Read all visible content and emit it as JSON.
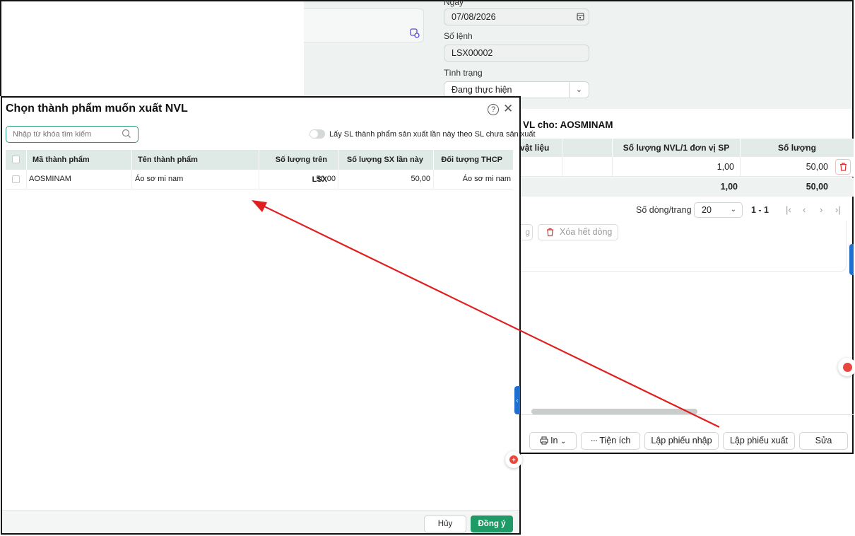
{
  "background_form": {
    "ngay_label": "Ngày",
    "ngay_value": "07/08/2026",
    "solenh_label": "Số lệnh",
    "solenh_value": "LSX00002",
    "tinhtrang_label": "Tình trạng",
    "tinhtrang_value": "Đang thực hiện"
  },
  "nvl_table": {
    "title": "VL cho: AOSMINAM",
    "columns": [
      "vật liệu",
      "",
      "Số lượng NVL/1 đơn vị SP",
      "Số lượng"
    ],
    "row": {
      "nvl_per_unit": "1,00",
      "quantity": "50,00"
    },
    "totals": {
      "nvl_per_unit": "1,00",
      "quantity": "50,00"
    }
  },
  "pager": {
    "rows_label": "Số dòng/trang",
    "rows_value": "20",
    "range": "1 - 1",
    "first": "|‹",
    "prev": "‹",
    "next": "›",
    "last": "›|"
  },
  "actions": {
    "partial_label": "g",
    "delete_all_label": "Xóa hết dòng"
  },
  "bottom_buttons": {
    "print": "In",
    "utilities": "Tiện ích",
    "create_receipt": "Lập phiếu nhập",
    "create_issue": "Lập phiếu xuất",
    "edit": "Sửa"
  },
  "dialog": {
    "title": "Chọn thành phẩm muốn xuất NVL",
    "search_placeholder": "Nhập từ khóa tìm kiếm",
    "toggle_label": "Lấy SL thành phẩm sản xuất lần này theo SL chưa sản xuất",
    "toggle_on": false,
    "columns": [
      "Mã thành phẩm",
      "Tên thành phẩm",
      "Số lượng trên LSX",
      "Số lượng SX lần này",
      "Đối tượng THCP"
    ],
    "rows": [
      {
        "code": "AOSMINAM",
        "name": "Áo sơ mi nam",
        "qty_lsx": "50,00",
        "qty_this": "50,00",
        "cost_object": "Áo sơ mi nam"
      }
    ],
    "cancel_label": "Hủy",
    "ok_label": "Đồng ý"
  },
  "colors": {
    "accent_green": "#1d9a66",
    "arrow_red": "#e02020",
    "header_bg": "#dfe9e5"
  }
}
